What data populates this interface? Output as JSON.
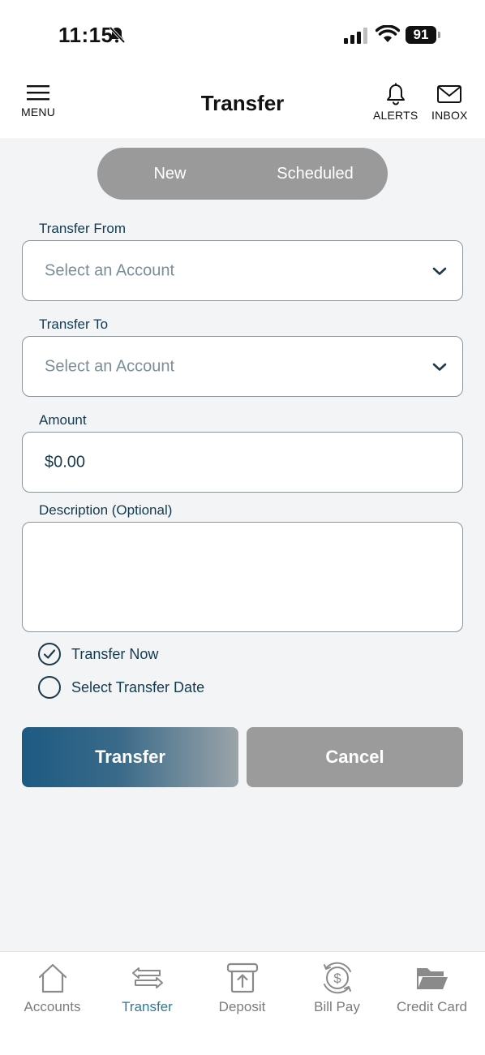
{
  "status_bar": {
    "time": "11:15",
    "battery": "91"
  },
  "header": {
    "title": "Transfer",
    "menu_label": "MENU",
    "alerts_label": "ALERTS",
    "inbox_label": "INBOX"
  },
  "tabs": {
    "new_label": "New",
    "scheduled_label": "Scheduled"
  },
  "form": {
    "from_label": "Transfer From",
    "from_placeholder": "Select an Account",
    "to_label": "Transfer To",
    "to_placeholder": "Select an Account",
    "amount_label": "Amount",
    "amount_value": "$0.00",
    "description_label": "Description (Optional)",
    "description_value": "",
    "option_now": "Transfer Now",
    "option_date": "Select Transfer Date",
    "selected_option": "Transfer Now"
  },
  "actions": {
    "transfer_label": "Transfer",
    "cancel_label": "Cancel"
  },
  "bottom_nav": {
    "items": [
      {
        "label": "Accounts",
        "icon": "home-icon"
      },
      {
        "label": "Transfer",
        "icon": "transfer-arrows-icon",
        "active": true
      },
      {
        "label": "Deposit",
        "icon": "deposit-icon"
      },
      {
        "label": "Bill Pay",
        "icon": "bill-pay-icon"
      },
      {
        "label": "Credit Card",
        "icon": "folder-icon"
      }
    ]
  },
  "colors": {
    "accent": "#1d5a82",
    "nav_active": "#2a7c95",
    "background": "#f2f4f6",
    "segment_bg": "#9a9a9a",
    "cancel_bg": "#9b9b9b"
  }
}
